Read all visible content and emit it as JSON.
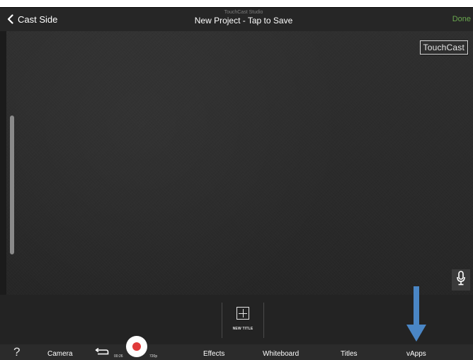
{
  "navbar": {
    "back_label": "Cast Side",
    "subtitle": "TouchCast Studio",
    "title": "New Project - Tap to Save",
    "done_label": "Done"
  },
  "canvas": {
    "watermark": "TouchCast"
  },
  "panel": {
    "new_title_label": "NEW TITLE"
  },
  "toolbar": {
    "help": "?",
    "camera": "Camera",
    "timer": "00:26",
    "quality": "720p",
    "effects": "Effects",
    "whiteboard": "Whiteboard",
    "titles": "Titles",
    "vapps": "vApps"
  },
  "colors": {
    "done": "#6aa84f",
    "record": "#e03a3a",
    "arrow": "#4a86c5"
  },
  "icons": [
    "chevron-left-icon",
    "microphone-icon",
    "plus-icon",
    "arrow-down-icon",
    "undo-icon",
    "record-icon",
    "help-icon"
  ]
}
